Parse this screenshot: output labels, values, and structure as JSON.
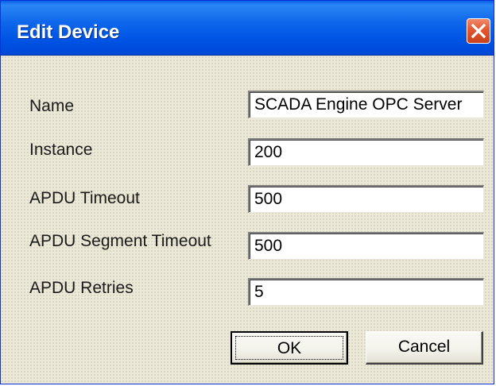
{
  "window": {
    "title": "Edit Device"
  },
  "form": {
    "name_label": "Name",
    "name_value": "SCADA Engine OPC Server",
    "instance_label": "Instance",
    "instance_value": "200",
    "apdu_timeout_label": "APDU Timeout",
    "apdu_timeout_value": "500",
    "apdu_segment_timeout_label": "APDU Segment Timeout",
    "apdu_segment_timeout_value": "500",
    "apdu_retries_label": "APDU Retries",
    "apdu_retries_value": "5"
  },
  "buttons": {
    "ok_label": "OK",
    "cancel_label": "Cancel"
  },
  "icons": {
    "close": "close-icon"
  },
  "colors": {
    "titlebar": "#0055e5",
    "close_button": "#e2572f",
    "dialog_background": "#ece9d8"
  }
}
